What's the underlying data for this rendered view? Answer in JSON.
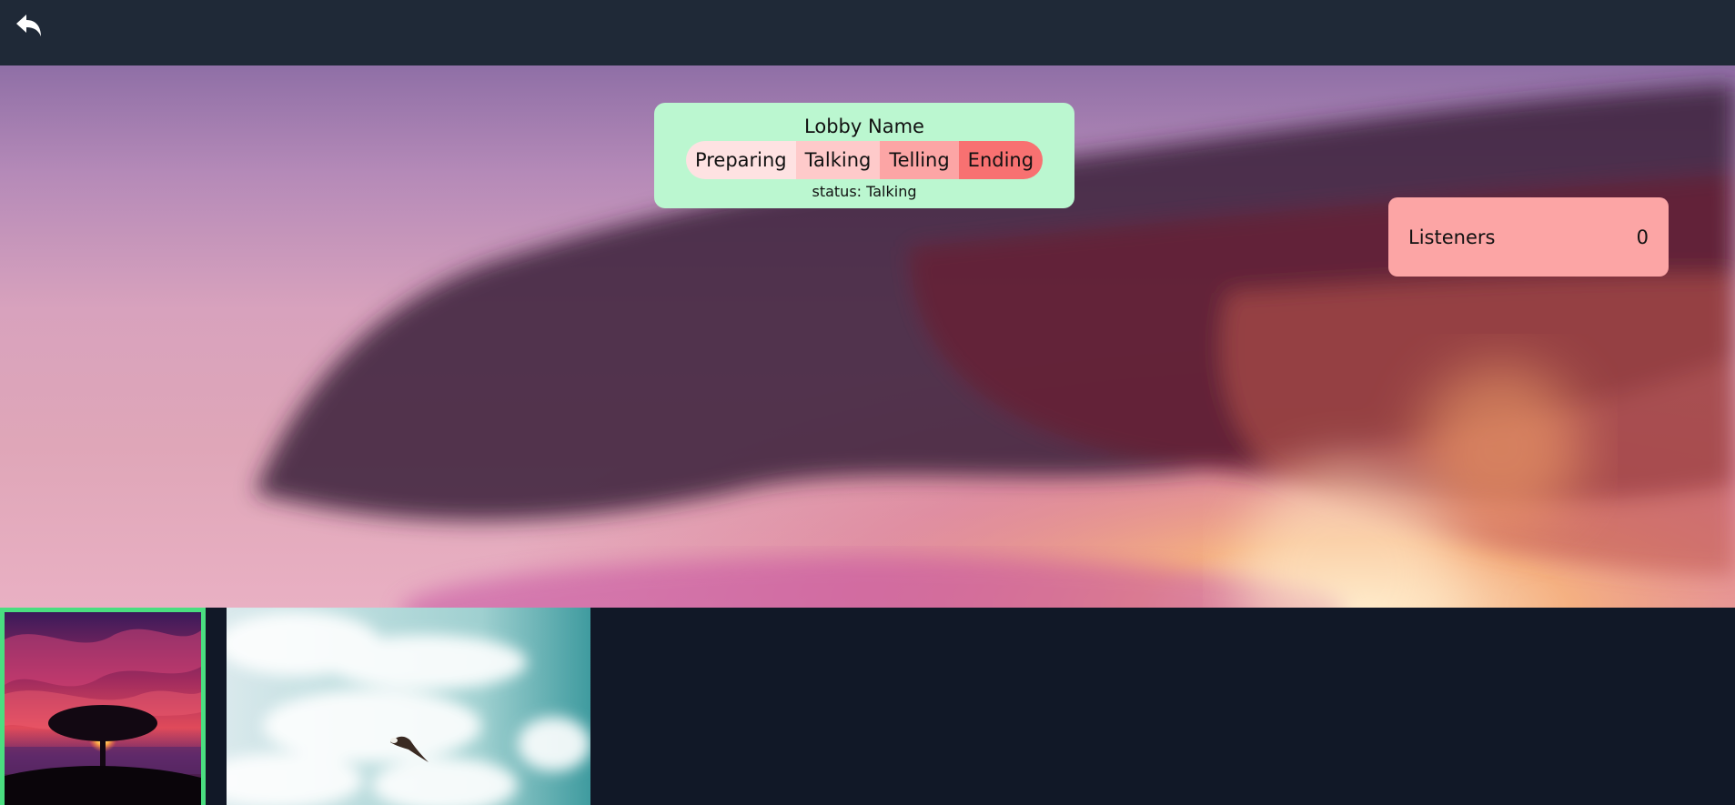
{
  "header": {
    "back_icon": "undo-arrow-icon"
  },
  "lobby": {
    "title": "Lobby Name",
    "phases": [
      "Preparing",
      "Talking",
      "Telling",
      "Ending"
    ],
    "status_text": "status: Talking"
  },
  "listeners": {
    "label": "Listeners",
    "count": "0"
  },
  "gallery": {
    "selected_index": 0,
    "colors": {
      "selected_border": "#4ade80",
      "lobby_card": "#bbf7d0",
      "listeners_card": "#fca5a5"
    }
  }
}
